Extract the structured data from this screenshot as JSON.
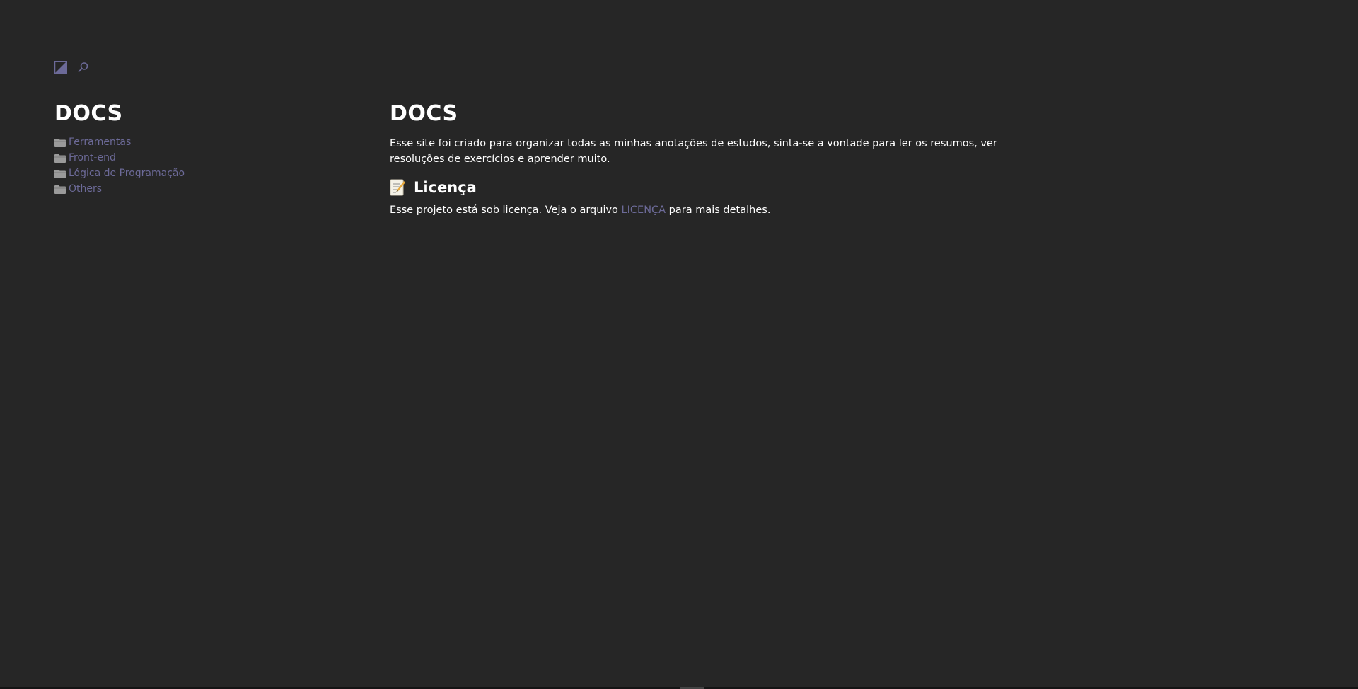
{
  "toolbar": {
    "theme_icon": "contrast-icon",
    "search_icon": "search-icon"
  },
  "sidebar": {
    "title": "DOCS",
    "items": [
      {
        "label": "Ferramentas",
        "icon": "folder-icon"
      },
      {
        "label": "Front-end",
        "icon": "folder-icon"
      },
      {
        "label": "Lógica de Programação",
        "icon": "folder-icon"
      },
      {
        "label": "Others",
        "icon": "folder-icon"
      }
    ]
  },
  "main": {
    "title": "DOCS",
    "intro": "Esse site foi criado para organizar todas as minhas anotações de estudos, sinta-se a vontade para ler os resumos, ver resoluções de exercícios e aprender muito.",
    "license_section": {
      "icon": "memo-icon",
      "title": "Licença",
      "text_before": "Esse projeto está sob licença. Veja o arquivo ",
      "link_label": "LICENÇA",
      "text_after": " para mais detalhes."
    }
  },
  "colors": {
    "background": "#262626",
    "text": "#ffffff",
    "link": "#6c6a98",
    "folder": "#9a9a9a"
  }
}
